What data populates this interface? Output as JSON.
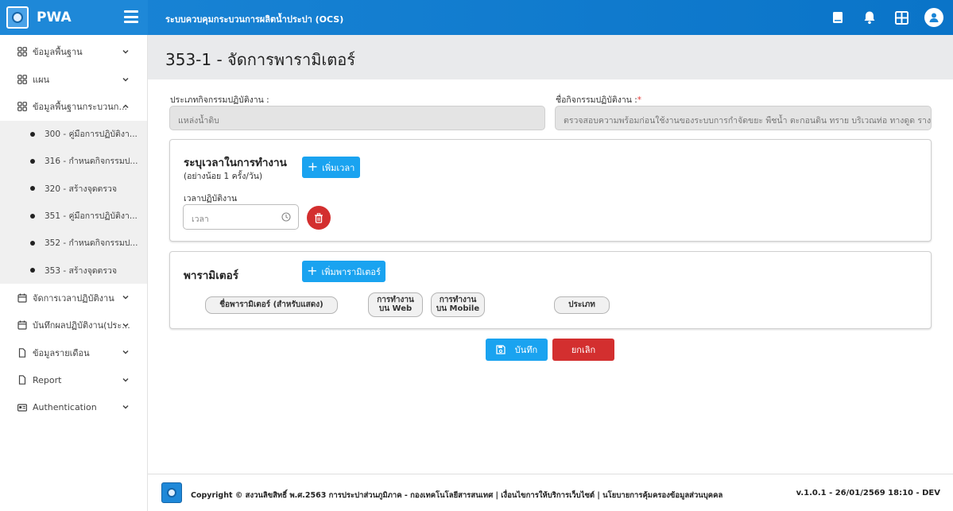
{
  "brand": {
    "name": "PWA"
  },
  "header": {
    "app_title": "ระบบควบคุมกระบวนการผลิตน้ำประปา (OCS)",
    "icons": [
      "book-icon",
      "bell-icon",
      "grid-icon",
      "user-icon"
    ]
  },
  "sidebar": {
    "items": [
      {
        "label": "ข้อมูลพื้นฐาน",
        "icon": "grid-icon",
        "expanded": false
      },
      {
        "label": "แผน",
        "icon": "grid-icon",
        "expanded": false
      },
      {
        "label": "ข้อมูลพื้นฐานกระบวนก...",
        "icon": "grid-icon",
        "expanded": true
      }
    ],
    "sub_items": [
      {
        "label": "300 - คู่มือการปฏิบัติงา..."
      },
      {
        "label": "316 - กำหนดกิจกรรมป..."
      },
      {
        "label": "320 - สร้างจุดตรวจ"
      },
      {
        "label": "351 - คู่มือการปฏิบัติงา..."
      },
      {
        "label": "352 - กำหนดกิจกรรมป..."
      },
      {
        "label": "353 - สร้างจุดตรวจ"
      }
    ],
    "lower_items": [
      {
        "label": "จัดการเวลาปฏิบัติงาน",
        "icon": "calendar-icon"
      },
      {
        "label": "บันทึกผลปฏิบัติงาน(ประ...",
        "icon": "calendar-icon"
      },
      {
        "label": "ข้อมูลรายเดือน",
        "icon": "document-icon"
      },
      {
        "label": "Report",
        "icon": "document-icon"
      },
      {
        "label": "Authentication",
        "icon": "id-card-icon"
      }
    ]
  },
  "page": {
    "title": "353-1 - จัดการพารามิเตอร์"
  },
  "form": {
    "activity_type_label": "ประเภทกิจกรรมปฏิบัติงาน :",
    "activity_type_value": "แหล่งน้ำดิบ",
    "activity_name_label": "ชื่อกิจกรรมปฏิบัติงาน :",
    "activity_name_required": "*",
    "activity_name_value": "ตรวจสอบความพร้อมก่อนใช้งานของระบบการกำจัดขยะ พืชน้ำ ตะกอนดิน ทราย บริเวณท่อ ทางดูด รางรับ"
  },
  "time_card": {
    "title": "ระบุเวลาในการทำงาน",
    "subtitle": "(อย่างน้อย 1 ครั้ง/วัน)",
    "add_button": "เพิ่มเวลา",
    "field_label": "เวลาปฏิบัติงาน",
    "time_placeholder": "เวลา"
  },
  "param_card": {
    "title": "พารามิเตอร์",
    "add_button": "เพิ่มพารามิเตอร์",
    "columns": {
      "name": "ชื่อพารามิเตอร์ (สำหรับแสดง)",
      "web_line1": "การทำงาน",
      "web_line2": "บน Web",
      "mobile_line1": "การทำงาน",
      "mobile_line2": "บน Mobile",
      "type": "ประเภท"
    }
  },
  "actions": {
    "save": "บันทึก",
    "cancel": "ยกเลิก"
  },
  "footer": {
    "copyright": "Copyright © สงวนลิขสิทธิ์ พ.ศ.2563 การประปาส่วนภูมิภาค - กองเทคโนโลยีสารสนเทศ | เงื่อนไขการให้บริการเว็บไซต์ | นโยบายการคุ้มครองข้อมูลส่วนบุคคล",
    "version": "v.1.0.1 - 26/01/2569 18:10 - DEV"
  },
  "colors": {
    "primary": "#1aa3f0",
    "header": "#1a85d6",
    "danger": "#d32f2f"
  }
}
